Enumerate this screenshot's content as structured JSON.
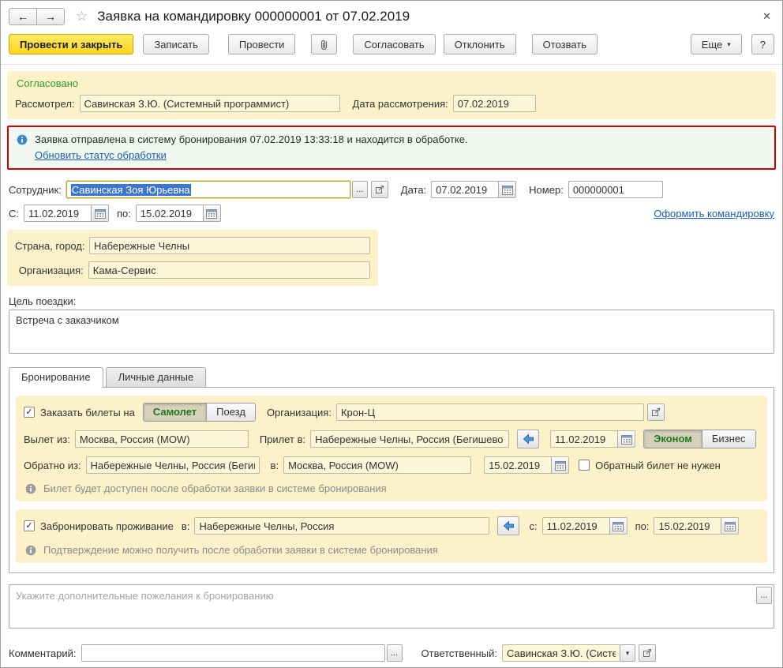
{
  "window": {
    "title": "Заявка на командировку 000000001 от 07.02.2019",
    "icons": {
      "back": "←",
      "forward": "→",
      "star": "☆",
      "close": "✕"
    }
  },
  "toolbar": {
    "post_and_close": "Провести и закрыть",
    "write": "Записать",
    "post": "Провести",
    "approve": "Согласовать",
    "decline": "Отклонить",
    "recall": "Отозвать",
    "more": "Еще",
    "help": "?"
  },
  "approval": {
    "status": "Согласовано",
    "reviewer_label": "Рассмотрел:",
    "reviewer": "Савинская З.Ю. (Системный программист)",
    "date_label": "Дата рассмотрения:",
    "date": "07.02.2019"
  },
  "notification": {
    "text": "Заявка отправлена в систему бронирования 07.02.2019 13:33:18 и находится в обработке.",
    "link": "Обновить статус обработки"
  },
  "form": {
    "employee_label": "Сотрудник:",
    "employee": "Савинская Зоя Юрьевна",
    "date_label": "Дата:",
    "date": "07.02.2019",
    "number_label": "Номер:",
    "number": "000000001",
    "from_label": "С:",
    "from_date": "11.02.2019",
    "to_label": "по:",
    "to_date": "15.02.2019",
    "trip_link": "Оформить командировку",
    "city_label": "Страна, город:",
    "city": "Набережные Челны",
    "org_label": "Организация:",
    "org": "Кама-Сервис",
    "purpose_label": "Цель поездки:",
    "purpose": "Встреча с заказчиком"
  },
  "tabs": {
    "booking": "Бронирование",
    "personal": "Личные данные"
  },
  "booking": {
    "order_tickets_label": "Заказать билеты на",
    "plane": "Самолет",
    "train": "Поезд",
    "org_label": "Организация:",
    "org": "Крон-Ц",
    "depart_from_label": "Вылет из:",
    "depart_from": "Москва, Россия (MOW)",
    "arrive_to_label": "Прилет в:",
    "arrive_to": "Набережные Челны, Россия (Бегишево",
    "depart_date": "11.02.2019",
    "economy": "Эконом",
    "business": "Бизнес",
    "return_from_label": "Обратно из:",
    "return_from": "Набережные Челны, Россия (Бегишево - N",
    "return_to_label": "в:",
    "return_to": "Москва, Россия (MOW)",
    "return_date": "15.02.2019",
    "no_return_label": "Обратный билет не нужен",
    "ticket_info": "Билет будет доступен после обработки заявки в системе бронирования",
    "hotel_label": "Забронировать проживание",
    "hotel_in_label": "в:",
    "hotel_city": "Набережные Челны, Россия",
    "hotel_from_label": "с:",
    "hotel_from_date": "11.02.2019",
    "hotel_to_label": "по:",
    "hotel_to_date": "15.02.2019",
    "hotel_info": "Подтверждение можно получить после обработки заявки в системе бронирования"
  },
  "wishes": {
    "placeholder": "Укажите дополнительные пожелания к бронированию"
  },
  "footer": {
    "comment_label": "Комментарий:",
    "comment": "",
    "responsible_label": "Ответственный:",
    "responsible": "Савинская З.Ю. (Системн"
  },
  "misc": {
    "ellipsis": "...",
    "dropdown": "▾",
    "check": "✓"
  },
  "colors": {
    "primary_button": "#ffd633",
    "group_background": "#fcf1c9",
    "alert_border": "#d00000",
    "alert_background": "#f1f8f1",
    "approved_status": "#2e9b2e",
    "link": "#1a5fb4",
    "selection": "#3b76d0",
    "toggle_active_text": "#1e7a1e"
  }
}
